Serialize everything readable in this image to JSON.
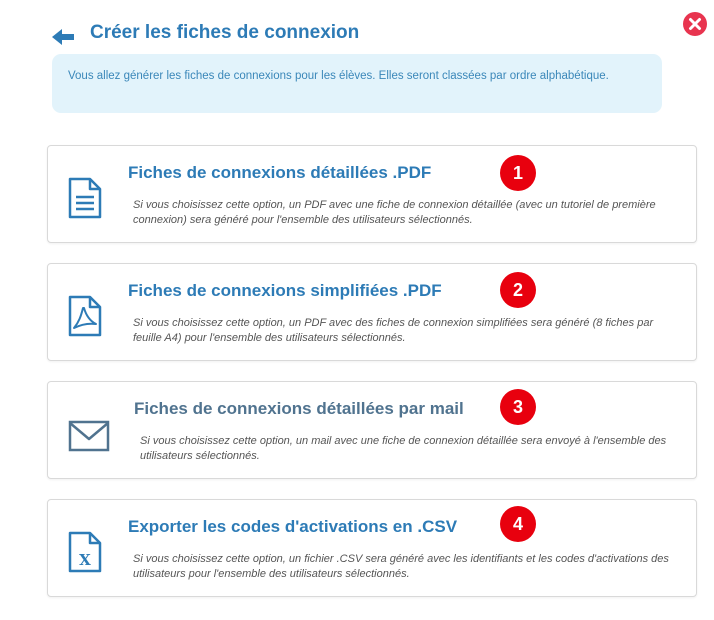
{
  "header": {
    "title": "Créer les fiches de connexion"
  },
  "info": {
    "text": "Vous allez générer les fiches de connexions pour les élèves. Elles seront classées par ordre alphabétique."
  },
  "options": [
    {
      "number": "1",
      "title": "Fiches de connexions détaillées .PDF",
      "description": "Si vous choisissez cette option, un PDF avec une fiche de connexion détaillée (avec un tutoriel de première connexion) sera généré pour l'ensemble des utilisateurs sélectionnés.",
      "icon": "document-icon"
    },
    {
      "number": "2",
      "title": "Fiches de connexions simplifiées .PDF",
      "description": "Si vous choisissez cette option, un PDF avec des fiches de connexion simplifiées sera généré (8 fiches par feuille A4) pour l'ensemble des utilisateurs sélectionnés.",
      "icon": "pdf-icon"
    },
    {
      "number": "3",
      "title": "Fiches de connexions détaillées par mail",
      "description": "Si vous choisissez cette option, un mail avec une fiche de connexion détaillée sera envoyé à l'ensemble des utilisateurs sélectionnés.",
      "icon": "envelope-icon"
    },
    {
      "number": "4",
      "title": "Exporter les codes d'activations en .CSV",
      "description": "Si vous choisissez cette option, un fichier .CSV sera généré avec les identifiants et les codes d'activations des utilisateurs pour l'ensemble des utilisateurs sélectionnés.",
      "icon": "excel-file-icon"
    }
  ],
  "colors": {
    "accent": "#2d7bb6",
    "badge": "#e8000e",
    "info_bg": "#e2f3fb",
    "close": "#e8344f"
  }
}
